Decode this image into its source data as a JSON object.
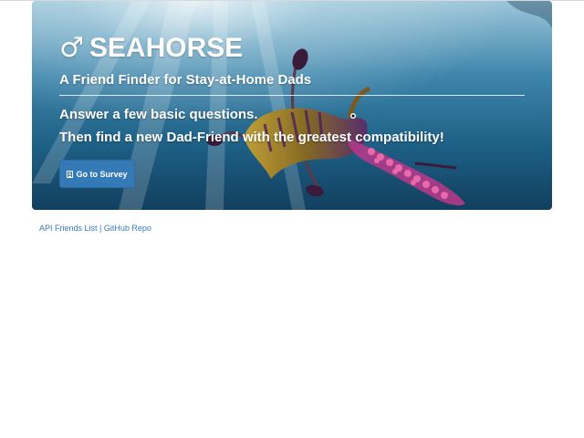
{
  "hero": {
    "icon": "male-symbol-icon",
    "icon_glyph": "♂",
    "title": "SEAHORSE",
    "subtitle": "A Friend Finder for Stay-at-Home Dads",
    "lead_line_1": "Answer a few basic questions.",
    "lead_line_2": "Then find a new Dad-Friend with the greatest compatibility!",
    "survey_button": {
      "icon": "list-icon",
      "label": "Go to Survey",
      "color": "#337ab7"
    }
  },
  "footer": {
    "api_link": "API Friends List",
    "separator": "|",
    "github_link": "GitHub Repo",
    "link_color": "#337ab7"
  }
}
